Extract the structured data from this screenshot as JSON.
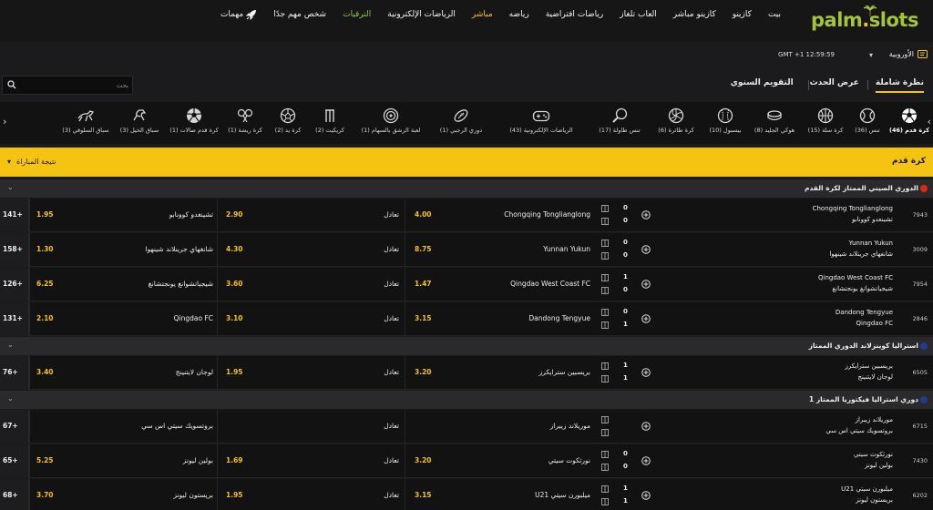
{
  "logo": {
    "text_left": "palm",
    "dot": ".",
    "text_right": "slots"
  },
  "nav": {
    "items": [
      "بيت",
      "كازينو",
      "كازينو مباشر",
      "العاب تلغاز",
      "رياضات افتراضية",
      "رياضه",
      "مباشر",
      "الرياضات الإلكترونية",
      "الترقيات",
      "شخص مهم جدًا",
      "مهمات"
    ]
  },
  "settings": {
    "odds_format": "الأوروبية",
    "timezone": "GMT +1 12:59:59"
  },
  "search": {
    "placeholder": "بحث"
  },
  "view_tabs": [
    "نظرة شاملة",
    "عرض الحدث",
    "التقويم السنوي"
  ],
  "sports": [
    {
      "label": "كرة قدم (46)",
      "icon": "soccer-ball-icon"
    },
    {
      "label": "تنس (36)",
      "icon": "tennis-ball-icon"
    },
    {
      "label": "كرة سلة (15)",
      "icon": "basketball-icon"
    },
    {
      "label": "هوكي الجليد (8)",
      "icon": "hockey-puck-icon"
    },
    {
      "label": "بيسبول (10)",
      "icon": "baseball-icon"
    },
    {
      "label": "كرة طائرة (6)",
      "icon": "volleyball-icon"
    },
    {
      "label": "تنس طاولة (17)",
      "icon": "table-tennis-icon"
    },
    {
      "label": "الرياضات الإلكترونية (43)",
      "icon": "gamepad-icon"
    },
    {
      "label": "دوري الرجبي (1)",
      "icon": "rugby-ball-icon"
    },
    {
      "label": "لعبة الرشق بالسهام (1)",
      "icon": "darts-target-icon"
    },
    {
      "label": "كريكيت (2)",
      "icon": "cricket-icon"
    },
    {
      "label": "كرة يد (2)",
      "icon": "handball-icon"
    },
    {
      "label": "كرة ريشة (1)",
      "icon": "badminton-icon"
    },
    {
      "label": "كرة قدم صالات (1)",
      "icon": "futsal-ball-icon"
    },
    {
      "label": "سباق الخيل (3)",
      "icon": "horse-racing-icon"
    },
    {
      "label": "سباق السلوقي (3)",
      "icon": "greyhound-racing-icon"
    }
  ],
  "section": {
    "title": "كرة قدم",
    "result_label": "نتيجة المباراة"
  },
  "colors": {
    "accent": "#f5c311",
    "brand_green": "#a4c43a",
    "promo_green": "#8cc63f",
    "bg": "#121213"
  },
  "leagues": [
    {
      "name": "الدوري الصيني الممتاز لكرة القدم",
      "flag_color": "#de2910",
      "events": [
        {
          "id": "7943",
          "home": "Chongqing Tonglianglong",
          "away": "تشينغدو كوونابو",
          "score_home": "0",
          "score_away": "0",
          "o1_name": "Chongqing Tonglianglong",
          "o1": "4.00",
          "ox_name": "تعادل",
          "ox": "2.90",
          "o2_name": "تشينغدو كوونابو",
          "o2": "1.95",
          "more": "141+"
        },
        {
          "id": "3009",
          "home": "Yunnan Yukun",
          "away": "شانغهاي جرينلاند شينهوا",
          "score_home": "0",
          "score_away": "0",
          "o1_name": "Yunnan Yukun",
          "o1": "8.75",
          "ox_name": "تعادل",
          "ox": "4.30",
          "o2_name": "شانغهاي جرينلاند شينهوا",
          "o2": "1.30",
          "more": "158+"
        },
        {
          "id": "7954",
          "home": "Qingdao West Coast FC",
          "away": "شيجياتشوانغ يونجتشانغ",
          "score_home": "1",
          "score_away": "0",
          "o1_name": "Qingdao West Coast FC",
          "o1": "1.47",
          "ox_name": "تعادل",
          "ox": "3.60",
          "o2_name": "شيجياتشوانغ يونجتشانغ",
          "o2": "6.25",
          "more": "126+"
        },
        {
          "id": "2846",
          "home": "Dandong Tengyue",
          "away": "Qingdao FC",
          "score_home": "0",
          "score_away": "1",
          "o1_name": "Dandong Tengyue",
          "o1": "3.15",
          "ox_name": "تعادل",
          "ox": "3.10",
          "o2_name": "Qingdao FC",
          "o2": "2.10",
          "more": "131+"
        }
      ]
    },
    {
      "name": "استراليا كوينزلاند الدوري الممتاز",
      "flag_color": "#1f3d8a",
      "events": [
        {
          "id": "6505",
          "home": "بريسبين سترايكرز",
          "away": "لوجان لايتنينج",
          "score_home": "1",
          "score_away": "1",
          "o1_name": "بريسبين سترايكرز",
          "o1": "3.20",
          "ox_name": "تعادل",
          "ox": "1.95",
          "o2_name": "لوجان لايتنينج",
          "o2": "3.40",
          "more": "76+"
        }
      ]
    },
    {
      "name": "دوري استراليا فيكتوريا الممتاز 1",
      "flag_color": "#1f3d8a",
      "events": [
        {
          "id": "6715",
          "home": "موريلاند زيبراز",
          "away": "بروتسويك سيتي اس سي",
          "score_home": "",
          "score_away": "",
          "o1_name": "موريلاند زيبراز",
          "o1": "",
          "ox_name": "تعادل",
          "ox": "",
          "o2_name": "بروتسويك سيتي اس سي",
          "o2": "",
          "more": "67+"
        },
        {
          "id": "7430",
          "home": "نورثكوت سيتي",
          "away": "بولين ليونز",
          "score_home": "0",
          "score_away": "0",
          "o1_name": "نورثكوت سيتي",
          "o1": "3.20",
          "ox_name": "تعادل",
          "ox": "1.69",
          "o2_name": "بولين ليونز",
          "o2": "5.25",
          "more": "65+"
        },
        {
          "id": "6202",
          "home": "ميلبورن سيتي U21",
          "away": "بريستون ليونز",
          "score_home": "1",
          "score_away": "1",
          "o1_name": "ميلبورن سيتي U21",
          "o1": "3.15",
          "ox_name": "تعادل",
          "ox": "1.95",
          "o2_name": "بريستون ليونز",
          "o2": "3.70",
          "more": "68+"
        }
      ]
    }
  ]
}
